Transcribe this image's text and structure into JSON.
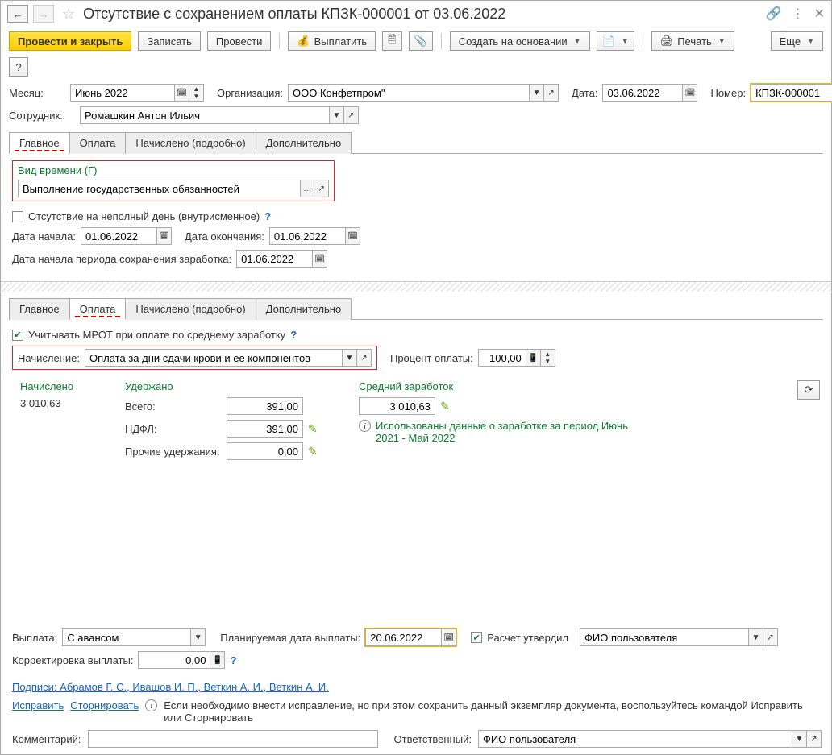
{
  "header": {
    "title": "Отсутствие с сохранением оплаты КПЗК-000001 от 03.06.2022"
  },
  "toolbar": {
    "post_close": "Провести и закрыть",
    "save": "Записать",
    "post": "Провести",
    "pay": "Выплатить",
    "create_on_basis": "Создать на основании",
    "print": "Печать",
    "more": "Еще"
  },
  "fields": {
    "month_lbl": "Месяц:",
    "month_val": "Июнь 2022",
    "org_lbl": "Организация:",
    "org_val": "ООО Конфетпром\"",
    "date_lbl": "Дата:",
    "date_val": "03.06.2022",
    "number_lbl": "Номер:",
    "number_val": "КПЗК-000001",
    "employee_lbl": "Сотрудник:",
    "employee_val": "Ромашкин Антон Ильич"
  },
  "tabs": {
    "main": "Главное",
    "payment": "Оплата",
    "accrued": "Начислено (подробно)",
    "extra": "Дополнительно"
  },
  "main_pane": {
    "time_type_lbl": "Вид времени (Г)",
    "time_type_val": "Выполнение государственных обязанностей",
    "partial_day_lbl": "Отсутствие на неполный день (внутрисменное)",
    "start_lbl": "Дата начала:",
    "start_val": "01.06.2022",
    "end_lbl": "Дата окончания:",
    "end_val": "01.06.2022",
    "keep_period_lbl": "Дата начала периода сохранения заработка:",
    "keep_period_val": "01.06.2022"
  },
  "pay_pane": {
    "mrot_lbl": "Учитывать МРОТ при оплате по среднему заработку",
    "accrual_lbl": "Начисление:",
    "accrual_val": "Оплата за дни сдачи крови и ее компонентов",
    "percent_lbl": "Процент оплаты:",
    "percent_val": "100,00",
    "accrued_h": "Начислено",
    "accrued_val": "3 010,63",
    "withheld_h": "Удержано",
    "total_lbl": "Всего:",
    "total_val": "391,00",
    "ndfl_lbl": "НДФЛ:",
    "ndfl_val": "391,00",
    "other_lbl": "Прочие удержания:",
    "other_val": "0,00",
    "avg_h": "Средний заработок",
    "avg_val": "3 010,63",
    "avg_info": "Использованы данные о заработке за период Июнь 2021 - Май 2022"
  },
  "payout": {
    "pay_lbl": "Выплата:",
    "pay_val": "С авансом",
    "plan_date_lbl": "Планируемая дата выплаты:",
    "plan_date_val": "20.06.2022",
    "approved_lbl": "Расчет утвердил",
    "resp_val": "ФИО пользователя",
    "corr_lbl": "Корректировка выплаты:",
    "corr_val": "0,00"
  },
  "footer": {
    "signatures": "Подписи: Абрамов Г. С., Ивашов И. П., Веткин А. И., Веткин А. И.",
    "fix": "Исправить",
    "storno": "Сторнировать",
    "hint": "Если необходимо внести исправление, но при этом сохранить данный экземпляр документа, воспользуйтесь командой Исправить или Сторнировать",
    "comment_lbl": "Комментарий:",
    "resp_lbl": "Ответственный:",
    "resp_val": "ФИО пользователя"
  }
}
